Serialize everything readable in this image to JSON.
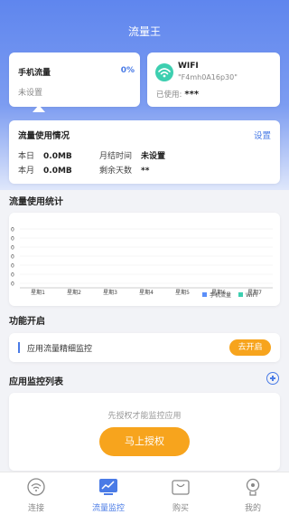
{
  "app": {
    "title": "流量王"
  },
  "mobile_card": {
    "title": "手机流量",
    "percent": "0%",
    "status": "未设置"
  },
  "wifi_card": {
    "title": "WIFI",
    "ssid": "\"F4mh0A16p30\"",
    "used_label": "已使用:",
    "used_value": "***"
  },
  "usage": {
    "title": "流量使用情况",
    "settings_label": "设置",
    "today_label": "本日",
    "today_value": "0.0MB",
    "month_label": "本月",
    "month_value": "0.0MB",
    "settle_label": "月结时间",
    "settle_value": "未设置",
    "remain_label": "剩余天数",
    "remain_value": "**"
  },
  "stats_title": "流量使用统计",
  "chart_data": {
    "type": "bar",
    "categories": [
      "星期1",
      "星期2",
      "星期3",
      "星期4",
      "星期5",
      "星期6",
      "星期7"
    ],
    "series": [
      {
        "name": "手机流量",
        "values": [
          0,
          0,
          0,
          0,
          0,
          0,
          0
        ],
        "color": "#5b8ff9"
      },
      {
        "name": "WIFI",
        "values": [
          0,
          0,
          0,
          0,
          0,
          0,
          0
        ],
        "color": "#3dcfb0"
      }
    ],
    "y_ticks": [
      "0",
      "0",
      "0",
      "0",
      "0",
      "0",
      "0"
    ],
    "grid": true,
    "legend": "bottom-right"
  },
  "features": {
    "title": "功能开启",
    "item_label": "应用流量精细监控",
    "open_label": "去开启"
  },
  "app_monitor": {
    "title": "应用监控列表",
    "hint": "先授权才能监控应用",
    "auth_label": "马上授权"
  },
  "tabs": [
    {
      "label": "连接",
      "icon": "wifi-icon"
    },
    {
      "label": "流量监控",
      "icon": "monitor-icon",
      "active": true
    },
    {
      "label": "购买",
      "icon": "cart-icon"
    },
    {
      "label": "我的",
      "icon": "profile-icon"
    }
  ],
  "colors": {
    "accent": "#4a7be6",
    "orange": "#f7a41d",
    "teal": "#3dcfb0"
  }
}
